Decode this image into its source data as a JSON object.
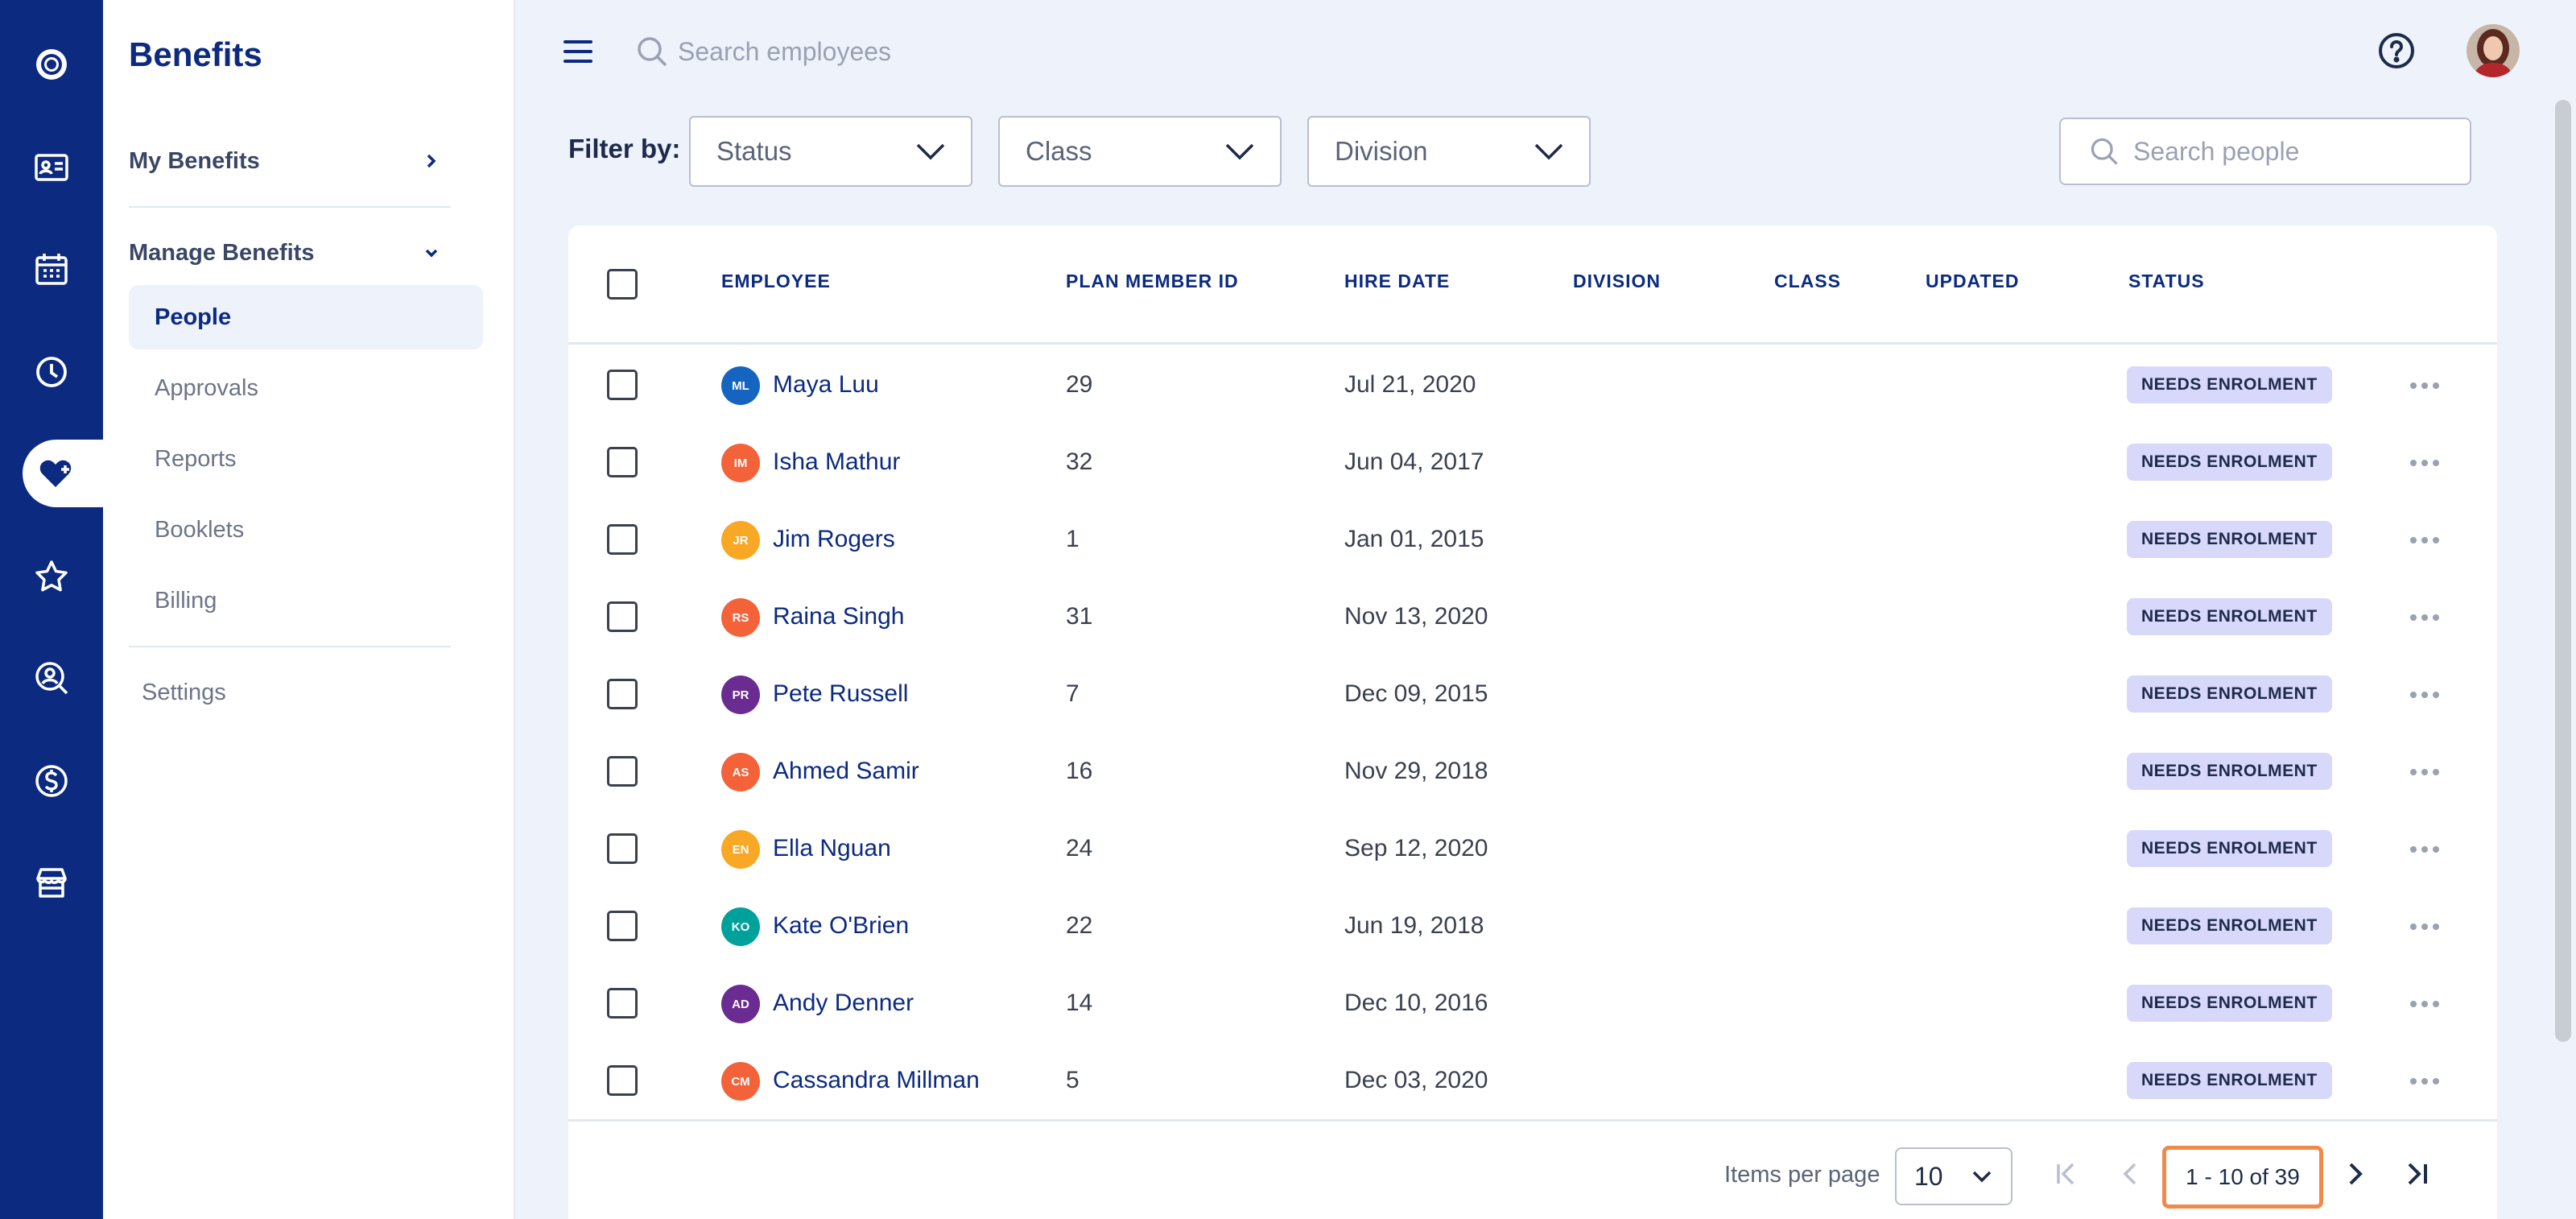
{
  "app": {
    "title": "Benefits"
  },
  "rail": {
    "items": [
      {
        "icon": "logo-ring-icon"
      },
      {
        "icon": "id-card-icon"
      },
      {
        "icon": "calendar-icon"
      },
      {
        "icon": "clock-icon"
      },
      {
        "icon": "heart-plus-icon",
        "active": true
      },
      {
        "icon": "star-icon"
      },
      {
        "icon": "people-search-icon"
      },
      {
        "icon": "dollar-icon"
      },
      {
        "icon": "store-icon"
      }
    ]
  },
  "sidenav": {
    "my_benefits": "My Benefits",
    "manage_benefits": "Manage Benefits",
    "items": [
      {
        "label": "People",
        "active": true
      },
      {
        "label": "Approvals"
      },
      {
        "label": "Reports"
      },
      {
        "label": "Booklets"
      },
      {
        "label": "Billing"
      }
    ],
    "settings": "Settings"
  },
  "topbar": {
    "search_placeholder": "Search employees"
  },
  "filters": {
    "label": "Filter by:",
    "status": "Status",
    "class": "Class",
    "division": "Division",
    "search_placeholder": "Search people"
  },
  "table": {
    "columns": {
      "employee": "EMPLOYEE",
      "plan_member_id": "PLAN MEMBER ID",
      "hire_date": "HIRE DATE",
      "division": "DIVISION",
      "class": "CLASS",
      "updated": "UPDATED",
      "status": "STATUS"
    },
    "rows": [
      {
        "initials": "ML",
        "name": "Maya Luu",
        "id": "29",
        "hire": "Jul 21, 2020",
        "status": "NEEDS ENROLMENT",
        "color": "#1565c0"
      },
      {
        "initials": "IM",
        "name": "Isha Mathur",
        "id": "32",
        "hire": "Jun 04, 2017",
        "status": "NEEDS ENROLMENT",
        "color": "#f4623a"
      },
      {
        "initials": "JR",
        "name": "Jim Rogers",
        "id": "1",
        "hire": "Jan 01, 2015",
        "status": "NEEDS ENROLMENT",
        "color": "#f9a825"
      },
      {
        "initials": "RS",
        "name": "Raina Singh",
        "id": "31",
        "hire": "Nov 13, 2020",
        "status": "NEEDS ENROLMENT",
        "color": "#f4623a"
      },
      {
        "initials": "PR",
        "name": "Pete Russell",
        "id": "7",
        "hire": "Dec 09, 2015",
        "status": "NEEDS ENROLMENT",
        "color": "#6a2c91"
      },
      {
        "initials": "AS",
        "name": "Ahmed Samir",
        "id": "16",
        "hire": "Nov 29, 2018",
        "status": "NEEDS ENROLMENT",
        "color": "#f4623a"
      },
      {
        "initials": "EN",
        "name": "Ella Nguan",
        "id": "24",
        "hire": "Sep 12, 2020",
        "status": "NEEDS ENROLMENT",
        "color": "#f9a825"
      },
      {
        "initials": "KO",
        "name": "Kate O'Brien",
        "id": "22",
        "hire": "Jun 19, 2018",
        "status": "NEEDS ENROLMENT",
        "color": "#00a19a"
      },
      {
        "initials": "AD",
        "name": "Andy Denner",
        "id": "14",
        "hire": "Dec 10, 2016",
        "status": "NEEDS ENROLMENT",
        "color": "#6a2c91"
      },
      {
        "initials": "CM",
        "name": "Cassandra Millman",
        "id": "5",
        "hire": "Dec 03, 2020",
        "status": "NEEDS ENROLMENT",
        "color": "#f4623a"
      }
    ]
  },
  "pagination": {
    "items_per_page_label": "Items per page",
    "items_per_page": "10",
    "range": "1 - 10 of 39"
  },
  "colors": {
    "brand": "#0b2a80",
    "badge": "#d7d8fa",
    "highlight": "#f08a4b"
  }
}
